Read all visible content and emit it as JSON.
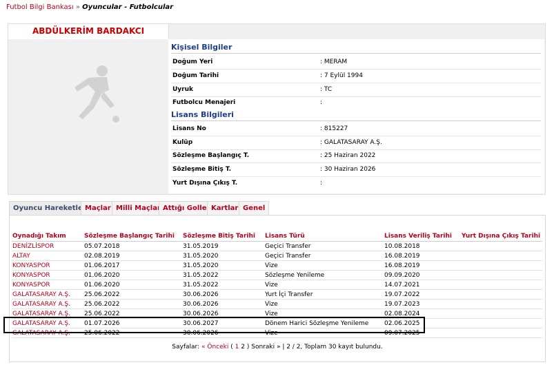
{
  "breadcrumb": {
    "root": "Futbol Bilgi Bankası",
    "separator": "»",
    "current": "Oyuncular - Futbolcular"
  },
  "player": {
    "name": "ABDÜLKERİM BARDAKCI"
  },
  "personal": {
    "title": "Kişisel Bilgiler",
    "rows": [
      {
        "label": "Doğum Yeri",
        "value": ":  MERAM"
      },
      {
        "label": "Doğum Tarihi",
        "value": ":  7 Eylül 1994"
      },
      {
        "label": "Uyruk",
        "value": ":  TC"
      },
      {
        "label": "Futbolcu Menajeri",
        "value": ":"
      }
    ]
  },
  "license": {
    "title": "Lisans Bilgileri",
    "rows": [
      {
        "label": "Lisans No",
        "value": ": 815227"
      },
      {
        "label": "Kulüp",
        "value": ": GALATASARAY A.Ş."
      },
      {
        "label": "Sözleşme Başlangıç T.",
        "value": ": 25 Haziran 2022"
      },
      {
        "label": "Sözleşme Bitiş T.",
        "value": ": 30 Haziran 2026"
      },
      {
        "label": "Yurt Dışına Çıkış T.",
        "value": ":"
      }
    ]
  },
  "tabs": [
    "Oyuncu Hareketleri",
    "Maçlar",
    "Milli Maçlar",
    "Attığı Goller",
    "Kartlar",
    "Genel"
  ],
  "history": {
    "columns": [
      "Oynadığı Takım",
      "Sözleşme Başlangıç Tarihi",
      "Sözleşme Bitiş Tarihi",
      "Lisans Türü",
      "Lisans Veriliş Tarihi",
      "Yurt Dışına Çıkış Tarihi"
    ],
    "rows": [
      [
        "DENİZLİSPOR",
        "05.07.2018",
        "31.05.2019",
        "Geçici Transfer",
        "10.08.2018",
        ""
      ],
      [
        "ALTAY",
        "02.08.2019",
        "31.05.2020",
        "Geçici Transfer",
        "16.08.2019",
        ""
      ],
      [
        "KONYASPOR",
        "01.06.2017",
        "31.05.2020",
        "Vize",
        "16.08.2019",
        ""
      ],
      [
        "KONYASPOR",
        "01.06.2020",
        "31.05.2022",
        "Sözleşme Yenileme",
        "09.09.2020",
        ""
      ],
      [
        "KONYASPOR",
        "01.06.2020",
        "31.05.2022",
        "Vize",
        "14.07.2021",
        ""
      ],
      [
        "GALATASARAY A.Ş.",
        "25.06.2022",
        "30.06.2026",
        "Yurt İçi Transfer",
        "19.07.2022",
        ""
      ],
      [
        "GALATASARAY A.Ş.",
        "25.06.2022",
        "30.06.2026",
        "Vize",
        "19.07.2023",
        ""
      ],
      [
        "GALATASARAY A.Ş.",
        "25.06.2022",
        "30.06.2026",
        "Vize",
        "02.08.2024",
        ""
      ],
      [
        "GALATASARAY A.Ş.",
        "01.07.2026",
        "30.06.2027",
        "Dönem Harici Sözleşme Yenileme",
        "02.06.2025",
        ""
      ],
      [
        "GALATASARAY A.Ş.",
        "25.06.2022",
        "30.06.2026",
        "Vize",
        "09.07.2025",
        ""
      ]
    ]
  },
  "pager": {
    "label": "Sayfalar:",
    "prev": "« Önceki",
    "open": "(",
    "page1": "1",
    "page2": "2",
    "close": ")",
    "next": "Sonraki »",
    "summary": "| 2 / 2, Toplam 30 kayıt bulundu."
  },
  "colors": {
    "accent": "#b3001b",
    "section": "#1f3c88",
    "name": "#cc0000"
  }
}
